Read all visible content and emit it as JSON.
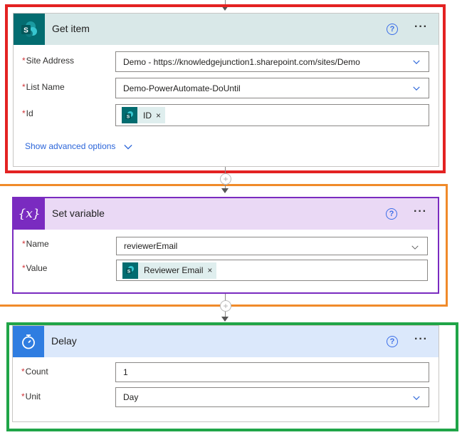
{
  "flow": {
    "get_item": {
      "title": "Get item",
      "help": "?",
      "more": "···",
      "fields": {
        "site_address": {
          "label": "Site Address",
          "value": "Demo - https://knowledgejunction1.sharepoint.com/sites/Demo"
        },
        "list_name": {
          "label": "List Name",
          "value": "Demo-PowerAutomate-DoUntil"
        },
        "id": {
          "label": "Id",
          "token": "ID"
        }
      },
      "advanced": "Show advanced options"
    },
    "set_variable": {
      "title": "Set variable",
      "icon_text": "{x}",
      "help": "?",
      "more": "···",
      "fields": {
        "name": {
          "label": "Name",
          "value": "reviewerEmail"
        },
        "value": {
          "label": "Value",
          "token": "Reviewer Email"
        }
      }
    },
    "delay": {
      "title": "Delay",
      "help": "?",
      "more": "···",
      "fields": {
        "count": {
          "label": "Count",
          "value": "1"
        },
        "unit": {
          "label": "Unit",
          "value": "Day"
        }
      }
    }
  },
  "common": {
    "required_mark": "*",
    "remove_token": "×",
    "plus": "+"
  },
  "colors": {
    "sharepoint": "#036c70",
    "variable": "#7a2bc0",
    "delay": "#2f7de1",
    "highlight_red": "#e32222",
    "highlight_orange": "#f08a2a",
    "highlight_green": "#20a548"
  },
  "icons": [
    "sharepoint-icon",
    "variable-icon",
    "timer-icon",
    "help-icon",
    "more-icon",
    "chevron-down-icon",
    "close-icon",
    "plus-icon"
  ]
}
